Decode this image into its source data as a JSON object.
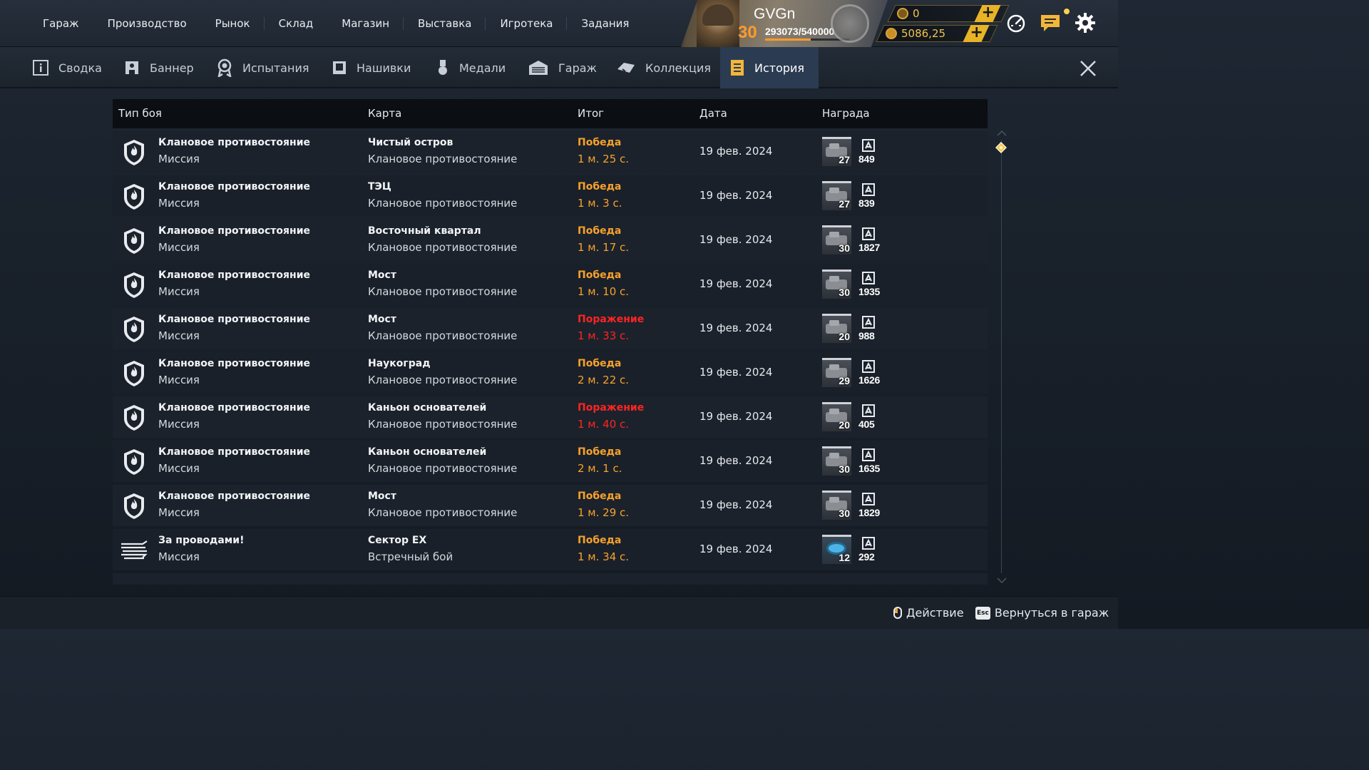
{
  "colors": {
    "win": "#f7a22d",
    "loss": "#ff2424",
    "accent": "#ff9b2c",
    "active_tab": "#2b3b52"
  },
  "topnav": [
    {
      "label": "Гараж"
    },
    {
      "label": "Производство"
    },
    {
      "label": "Рынок"
    },
    {
      "label": "Склад"
    },
    {
      "label": "Магазин"
    },
    {
      "label": "Выставка"
    },
    {
      "label": "Игротека"
    },
    {
      "label": "Задания"
    }
  ],
  "profile": {
    "nickname": "GVGn",
    "level": "30",
    "xp": "293073/540000",
    "xp_fraction": 0.5427
  },
  "currency": {
    "coins": "0",
    "crowns": "5086,25",
    "coins_icon": "coin-icon",
    "crowns_icon": "silver-coin-icon"
  },
  "header_icons": [
    "speedometer-icon",
    "chat-icon",
    "gear-icon"
  ],
  "tabs": [
    {
      "label": "Сводка",
      "icon": "info-icon"
    },
    {
      "label": "Баннер",
      "icon": "banner-icon"
    },
    {
      "label": "Испытания",
      "icon": "medal-ribbon-icon"
    },
    {
      "label": "Нашивки",
      "icon": "patch-icon"
    },
    {
      "label": "Медали",
      "icon": "medal-icon"
    },
    {
      "label": "Гараж",
      "icon": "garage-icon"
    },
    {
      "label": "Коллекция",
      "icon": "collection-icon"
    },
    {
      "label": "История",
      "icon": "history-icon",
      "active": true
    }
  ],
  "table": {
    "headers": {
      "type": "Тип боя",
      "map": "Карта",
      "result": "Итог",
      "date": "Дата",
      "reward": "Награда"
    },
    "rows": [
      {
        "mode": "Клановое противостояние",
        "sub": "Миссия",
        "map": "Чистый остров",
        "map_sub": "Клановое противостояние",
        "result": "Победа",
        "duration": "1 м. 25 с.",
        "outcome": "win",
        "date": "19 фев. 2024",
        "reward_count": "27",
        "reward_badge": "849",
        "icon": "clan-shield-icon",
        "reward_type": "scrap"
      },
      {
        "mode": "Клановое противостояние",
        "sub": "Миссия",
        "map": "ТЭЦ",
        "map_sub": "Клановое противостояние",
        "result": "Победа",
        "duration": "1 м. 3 с.",
        "outcome": "win",
        "date": "19 фев. 2024",
        "reward_count": "27",
        "reward_badge": "839",
        "icon": "clan-shield-icon",
        "reward_type": "scrap"
      },
      {
        "mode": "Клановое противостояние",
        "sub": "Миссия",
        "map": "Восточный квартал",
        "map_sub": "Клановое противостояние",
        "result": "Победа",
        "duration": "1 м. 17 с.",
        "outcome": "win",
        "date": "19 фев. 2024",
        "reward_count": "30",
        "reward_badge": "1827",
        "icon": "clan-shield-icon",
        "reward_type": "scrap"
      },
      {
        "mode": "Клановое противостояние",
        "sub": "Миссия",
        "map": "Мост",
        "map_sub": "Клановое противостояние",
        "result": "Победа",
        "duration": "1 м. 10 с.",
        "outcome": "win",
        "date": "19 фев. 2024",
        "reward_count": "30",
        "reward_badge": "1935",
        "icon": "clan-shield-icon",
        "reward_type": "scrap"
      },
      {
        "mode": "Клановое противостояние",
        "sub": "Миссия",
        "map": "Мост",
        "map_sub": "Клановое противостояние",
        "result": "Поражение",
        "duration": "1 м. 33 с.",
        "outcome": "loss",
        "date": "19 фев. 2024",
        "reward_count": "20",
        "reward_badge": "988",
        "icon": "clan-shield-icon",
        "reward_type": "scrap"
      },
      {
        "mode": "Клановое противостояние",
        "sub": "Миссия",
        "map": "Наукоград",
        "map_sub": "Клановое противостояние",
        "result": "Победа",
        "duration": "2 м. 22 с.",
        "outcome": "win",
        "date": "19 фев. 2024",
        "reward_count": "29",
        "reward_badge": "1626",
        "icon": "clan-shield-icon",
        "reward_type": "scrap"
      },
      {
        "mode": "Клановое противостояние",
        "sub": "Миссия",
        "map": "Каньон основателей",
        "map_sub": "Клановое противостояние",
        "result": "Поражение",
        "duration": "1 м. 40 с.",
        "outcome": "loss",
        "date": "19 фев. 2024",
        "reward_count": "20",
        "reward_badge": "405",
        "icon": "clan-shield-icon",
        "reward_type": "scrap"
      },
      {
        "mode": "Клановое противостояние",
        "sub": "Миссия",
        "map": "Каньон основателей",
        "map_sub": "Клановое противостояние",
        "result": "Победа",
        "duration": "2 м. 1 с.",
        "outcome": "win",
        "date": "19 фев. 2024",
        "reward_count": "30",
        "reward_badge": "1635",
        "icon": "clan-shield-icon",
        "reward_type": "scrap"
      },
      {
        "mode": "Клановое противостояние",
        "sub": "Миссия",
        "map": "Мост",
        "map_sub": "Клановое противостояние",
        "result": "Победа",
        "duration": "1 м. 29 с.",
        "outcome": "win",
        "date": "19 фев. 2024",
        "reward_count": "30",
        "reward_badge": "1829",
        "icon": "clan-shield-icon",
        "reward_type": "scrap"
      },
      {
        "mode": "За проводами!",
        "sub": "Миссия",
        "map": "Сектор EX",
        "map_sub": "Встречный бой",
        "result": "Победа",
        "duration": "1 м. 34 с.",
        "outcome": "win",
        "date": "19 фев. 2024",
        "reward_count": "12",
        "reward_badge": "292",
        "icon": "wire-spool-icon",
        "reward_type": "disk"
      }
    ]
  },
  "footer": {
    "action_label": "Действие",
    "back_key": "Esc",
    "back_label": "Вернуться в гараж"
  }
}
